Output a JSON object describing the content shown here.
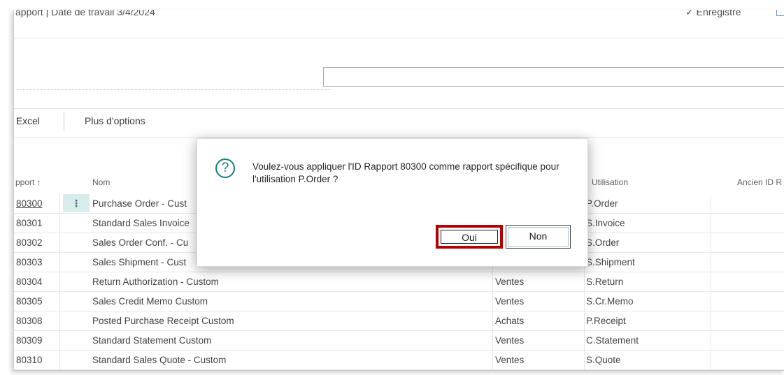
{
  "header": {
    "breadcrumb": "apport | Date de travail 3/4/2024",
    "saved_status": "✓ Enregistré"
  },
  "actions": {
    "excel_label": "Excel",
    "more_options_label": "Plus d'options"
  },
  "columns": {
    "id": "pport ↑",
    "name": "Nom",
    "usage": "Utilisation",
    "old_id": "Ancien ID R"
  },
  "rows": [
    {
      "id": "80300",
      "name": "Purchase Order - Cust",
      "type": "",
      "usage": "P.Order"
    },
    {
      "id": "80301",
      "name": "Standard Sales Invoice",
      "type": "",
      "usage": "S.Invoice"
    },
    {
      "id": "80302",
      "name": "Sales Order Conf. - Cu",
      "type": "",
      "usage": "S.Order"
    },
    {
      "id": "80303",
      "name": "Sales Shipment - Cust",
      "type": "",
      "usage": "S.Shipment"
    },
    {
      "id": "80304",
      "name": "Return Authorization - Custom",
      "type": "Ventes",
      "usage": "S.Return"
    },
    {
      "id": "80305",
      "name": "Sales Credit Memo Custom",
      "type": "Ventes",
      "usage": "S.Cr.Memo"
    },
    {
      "id": "80308",
      "name": "Posted Purchase Receipt Custom",
      "type": "Achats",
      "usage": "P.Receipt"
    },
    {
      "id": "80309",
      "name": "Standard Statement Custom",
      "type": "Ventes",
      "usage": "C.Statement"
    },
    {
      "id": "80310",
      "name": "Standard Sales Quote - Custom",
      "type": "Ventes",
      "usage": "S.Quote"
    }
  ],
  "dialog": {
    "message": "Voulez-vous appliquer l'ID Rapport 80300 comme rapport spécifique pour l'utilisation P.Order ?",
    "yes_label": "Oui",
    "no_label": "Non",
    "icon": "question-icon",
    "highlight_color": "#b00000"
  }
}
